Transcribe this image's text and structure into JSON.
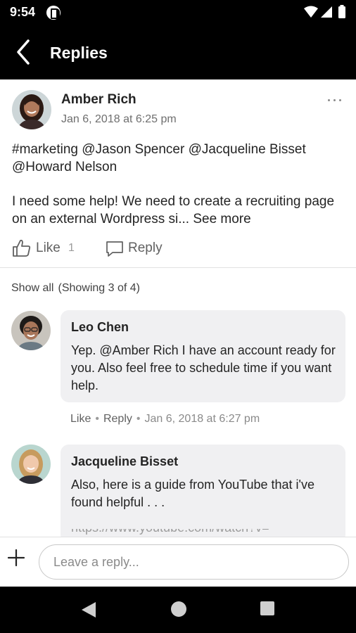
{
  "status_bar": {
    "time": "9:54",
    "icons": [
      "app-notification-icon",
      "wifi-icon",
      "cell-signal-icon",
      "battery-icon"
    ]
  },
  "app_bar": {
    "title": "Replies",
    "back_icon": "chevron-left-icon"
  },
  "post": {
    "author": "Amber Rich",
    "timestamp": "Jan 6, 2018 at 6:25 pm",
    "tags_text": "#marketing @Jason Spencer @Jacqueline Bisset @Howard Nelson",
    "body_text": "I need some help! We need to create a recruiting page on an external Wordpress si...",
    "see_more": "See more",
    "like_label": "Like",
    "like_count": "1",
    "reply_label": "Reply"
  },
  "comments_header": {
    "show_all": "Show all",
    "showing": "(Showing 3 of 4)"
  },
  "comments": [
    {
      "author": "Leo Chen",
      "text": "Yep. @Amber Rich I have an account ready for you.  Also feel free to schedule time if you want help.",
      "like": "Like",
      "reply": "Reply",
      "time": "Jan 6, 2018 at 6:27 pm"
    },
    {
      "author": "Jacqueline Bisset",
      "text": "Also, here is a guide from YouTube that i've found helpful . . .",
      "link_partial": "https://www.youtube.com/watch?v="
    }
  ],
  "reply_bar": {
    "placeholder": "Leave a reply..."
  },
  "colors": {
    "bar_background": "#000000",
    "bubble_background": "#f0f0f2",
    "secondary_text": "#6e6e6e"
  }
}
